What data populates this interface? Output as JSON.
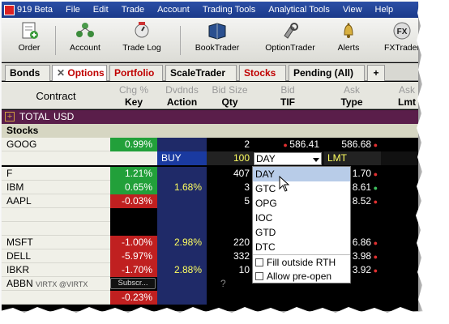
{
  "menubar": {
    "app": "919 Beta",
    "items": [
      "File",
      "Edit",
      "Trade",
      "Account",
      "Trading Tools",
      "Analytical Tools",
      "View",
      "Help"
    ]
  },
  "toolbar": {
    "buttons": [
      {
        "label": "Order",
        "icon": "order-icon"
      },
      {
        "label": "Account",
        "icon": "account-icon"
      },
      {
        "label": "Trade Log",
        "icon": "trade-log-icon"
      },
      {
        "label": "BookTrader",
        "icon": "booktrader-icon"
      },
      {
        "label": "OptionTrader",
        "icon": "optiontrader-icon"
      },
      {
        "label": "Alerts",
        "icon": "alerts-icon"
      },
      {
        "label": "FXTrader",
        "icon": "fxtrader-icon"
      }
    ]
  },
  "tabs": [
    {
      "label": "Bonds",
      "closable": false
    },
    {
      "label": "Options",
      "closable": true
    },
    {
      "label": "Portfolio",
      "closable": false
    },
    {
      "label": "ScaleTrader",
      "closable": false
    },
    {
      "label": "Stocks",
      "closable": false
    },
    {
      "label": "Pending (All)",
      "closable": false
    },
    {
      "label": "+",
      "closable": false
    }
  ],
  "header": {
    "contract": "Contract",
    "top": [
      "Chg %",
      "Dvdnds",
      "Bid Size",
      "Bid",
      "Ask",
      "Ask"
    ],
    "bottom": [
      "Key",
      "Action",
      "Qty",
      "TIF",
      "Type",
      "Lmt"
    ]
  },
  "grid": {
    "total": {
      "expand": "+",
      "label": "TOTAL",
      "currency": "USD"
    },
    "section": "Stocks",
    "rows": [
      {
        "symbol": "GOOG",
        "chg": "0.99%",
        "dir": "up",
        "dvd": "",
        "qty": "2",
        "bid": "586.41",
        "ask": "586.68",
        "dotcolor": "red"
      },
      {
        "symbol": "F",
        "chg": "1.21%",
        "dir": "up",
        "dvd": "",
        "qty": "407",
        "bid": "",
        "ask": "1.70",
        "dotcolor": "red"
      },
      {
        "symbol": "IBM",
        "chg": "0.65%",
        "dir": "up",
        "dvd": "1.68%",
        "qty": "3",
        "bid": "",
        "ask": "8.61",
        "dotcolor": "green"
      },
      {
        "symbol": "AAPL",
        "chg": "-0.03%",
        "dir": "dn",
        "dvd": "",
        "qty": "5",
        "bid": "",
        "ask": "8.52",
        "dotcolor": "red"
      },
      {
        "symbol": "MSFT",
        "chg": "-1.00%",
        "dir": "dn",
        "dvd": "2.98%",
        "qty": "220",
        "bid": "",
        "ask": "6.86",
        "dotcolor": "red"
      },
      {
        "symbol": "DELL",
        "chg": "-5.97%",
        "dir": "dn",
        "dvd": "",
        "qty": "332",
        "bid": "",
        "ask": "3.98",
        "dotcolor": "red"
      },
      {
        "symbol": "IBKR",
        "chg": "-1.70%",
        "dir": "dn",
        "dvd": "2.88%",
        "qty": "10",
        "bid": "",
        "ask": "3.92",
        "dotcolor": "red"
      },
      {
        "symbol": "ABBN",
        "exchange": "VIRTX @VIRTX",
        "subscribe": "Subscr...",
        "qty": "?"
      }
    ],
    "partial_row_chg": "-0.23%"
  },
  "order": {
    "action": "BUY",
    "qty": "100",
    "tif": "DAY",
    "type": "LMT"
  },
  "dropdown": {
    "options": [
      "DAY",
      "GTC",
      "OPG",
      "IOC",
      "GTD",
      "DTC"
    ],
    "selected": "DAY",
    "checkboxes": [
      "Fill outside RTH",
      "Allow pre-open"
    ]
  }
}
